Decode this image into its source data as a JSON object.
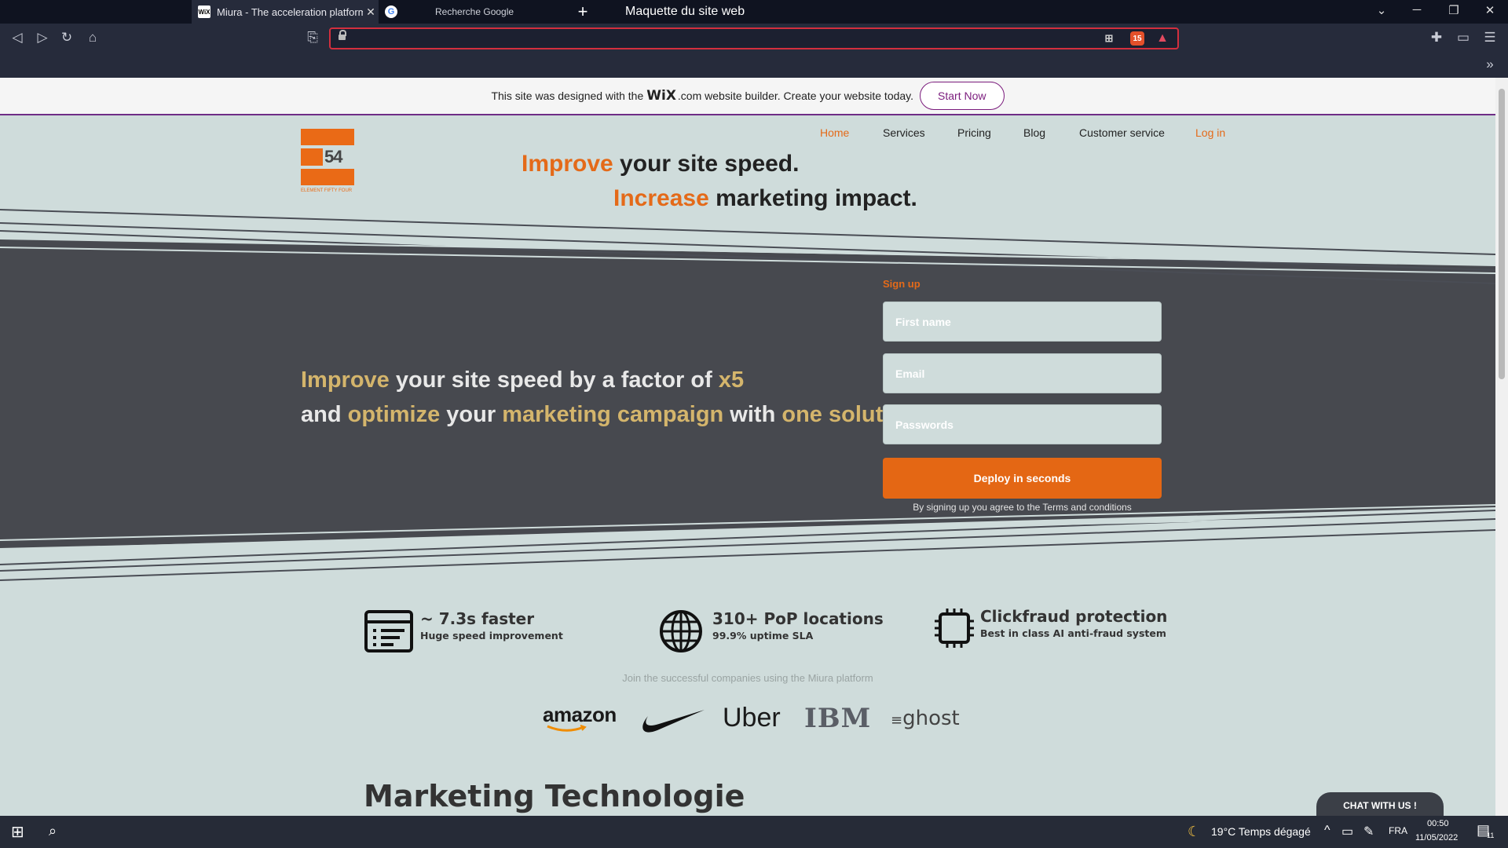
{
  "browser": {
    "tabs": [
      {
        "title": "Miura - The acceleration platform",
        "favicon": "wix-favicon",
        "active": true
      },
      {
        "title": "Recherche Google",
        "favicon": "google-favicon",
        "active": false
      }
    ],
    "window_title": "Maquette du site web",
    "url": "",
    "brave_shield_count": "15"
  },
  "wix_banner": {
    "text_before": "This site was designed with the",
    "wix_logo": "WiX",
    "text_after": ".com website builder. Create your website today.",
    "cta": "Start Now"
  },
  "site": {
    "logo_number": "54",
    "logo_caption": "ELEMENT FIFTY FOUR",
    "nav": [
      "Home",
      "Services",
      "Pricing",
      "Blog",
      "Customer service",
      "Log in"
    ],
    "hero": {
      "line1_accent": "Improve",
      "line1_rest": " your site speed.",
      "line2_accent": "Increase",
      "line2_rest": " marketing impact."
    },
    "pitch": {
      "l1a": "Improve",
      "l1b": " your site speed by a factor of ",
      "l1c": "x5",
      "l2a": "and ",
      "l2b": "optimize",
      "l2c": " your ",
      "l2d": "marketing campaign",
      "l2e": " with ",
      "l2f": "one solution"
    },
    "signup": {
      "label": "Sign up",
      "first_name_placeholder": "First name",
      "email_placeholder": "Email",
      "password_placeholder": "Passwords",
      "button": "Deploy in seconds",
      "terms": "By signing up you agree to the Terms and conditions"
    },
    "features": [
      {
        "icon": "server-icon",
        "title": "~ 7.3s faster",
        "subtitle": "Huge speed improvement"
      },
      {
        "icon": "globe-icon",
        "title": "310+ PoP locations",
        "subtitle": "99.9% uptime SLA"
      },
      {
        "icon": "chip-icon",
        "title": "Clickfraud protection",
        "subtitle": "Best in class AI anti-fraud system"
      }
    ],
    "join_text": "Join the successful companies using the Miura platform",
    "companies": [
      "amazon",
      "nike",
      "Uber",
      "IBM",
      "ghost"
    ],
    "section_title": "Marketing Technologie",
    "chat": "CHAT WITH US !"
  },
  "taskbar": {
    "weather": "19°C  Temps dégagé",
    "lang": "FRA",
    "time": "00:50",
    "date": "11/05/2022",
    "notification_count": "11"
  },
  "colors": {
    "accent_orange": "#e46a19",
    "dark_band": "#47494f",
    "page_bg": "#cfdcdb",
    "gold": "#d4b56c",
    "wix_purple": "#7b1c7d"
  }
}
